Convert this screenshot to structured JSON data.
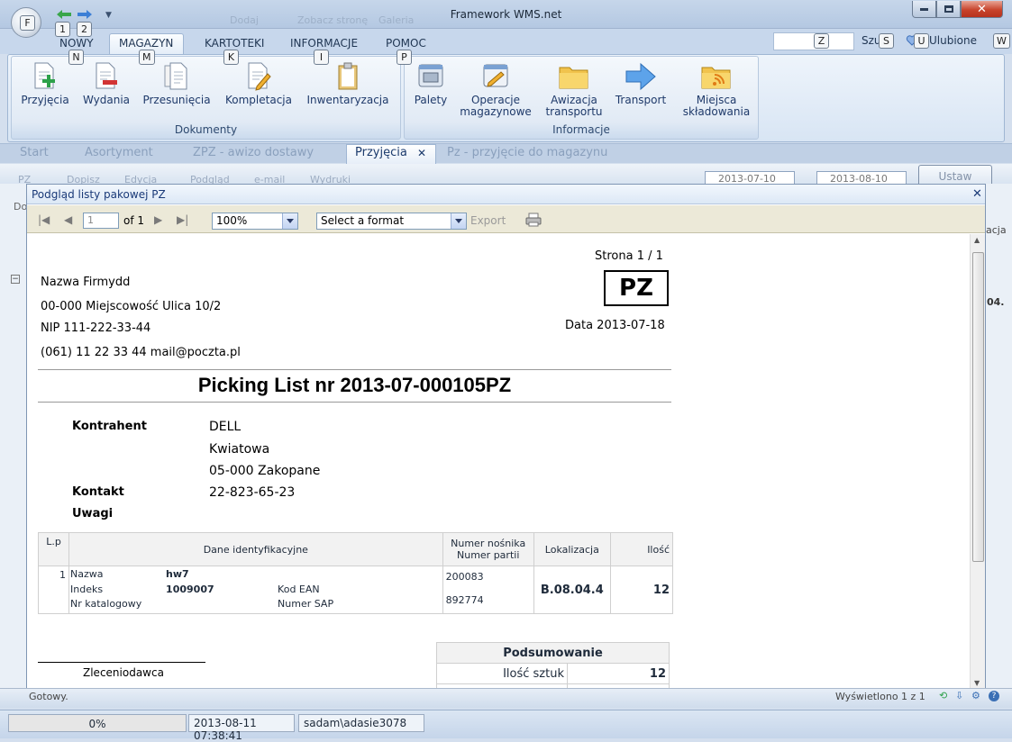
{
  "window": {
    "title": "Framework WMS.net",
    "app_button_key": "F",
    "qat_keys": [
      "1",
      "2"
    ],
    "ghost_items": [
      "Dodaj",
      "Zobacz stronę",
      "Galeria"
    ]
  },
  "ribbon": {
    "tabs": [
      {
        "label": "NOWY",
        "key": "N"
      },
      {
        "label": "MAGAZYN",
        "key": "M"
      },
      {
        "label": "KARTOTEKI",
        "key": "K"
      },
      {
        "label": "INFORMACJE",
        "key": "I"
      },
      {
        "label": "POMOC",
        "key": "P"
      }
    ],
    "search_key": "Z",
    "search_label": "Szuj",
    "search_key2": "S",
    "favorites_key": "U",
    "favorites_label": "Ulubione",
    "extra_key": "W",
    "groups": [
      {
        "label": "Dokumenty",
        "buttons": [
          "Przyjęcia",
          "Wydania",
          "Przesunięcia",
          "Kompletacja",
          "Inwentaryzacja"
        ]
      },
      {
        "label": "Informacje",
        "buttons": [
          "Palety",
          "Operacje magazynowe",
          "Awizacja transportu",
          "Transport",
          "Miejsca składowania"
        ]
      }
    ]
  },
  "doc_tabs": [
    "Start",
    "Asortyment",
    "ZPZ - awizo dostawy",
    "Przyjęcia",
    "Pz - przyjęcie do magazynu"
  ],
  "toolbar": {
    "items": [
      "PZ",
      "Dopisz",
      "Edycja",
      "Podgląd",
      "e-mail",
      "Wydruki"
    ],
    "date_from": "2013-07-10",
    "date_to": "2013-08-10",
    "apply_button": "Ustaw",
    "side_partial": [
      "Do",
      "acja",
      "04."
    ]
  },
  "dialog": {
    "title": "Podgląd listy pakowej PZ",
    "page_value": "1",
    "page_of": "of 1",
    "zoom": "100%",
    "format_placeholder": "Select a format",
    "export_label": "Export"
  },
  "report": {
    "page_label": "Strona 1 / 1",
    "doc_type": "PZ",
    "date_label": "Data 2013-07-18",
    "company": {
      "name": "Nazwa Firmydd",
      "address": "00-000 Miejscowość Ulica 10/2",
      "nip": "NIP 111-222-33-44",
      "contact": "(061) 11 22 33 44 mail@poczta.pl"
    },
    "heading": "Picking List nr 2013-07-000105PZ",
    "party": {
      "contractor_label": "Kontrahent",
      "contractor_name": "DELL",
      "street": "Kwiatowa",
      "city": "05-000 Zakopane",
      "contact_label": "Kontakt",
      "contact_value": "22-823-65-23",
      "notes_label": "Uwagi"
    },
    "table": {
      "headers": {
        "lp": "L.p",
        "ident": "Dane identyfikacyjne",
        "carrier_line1": "Numer nośnika",
        "carrier_line2": "Numer partii",
        "location": "Lokalizacja",
        "qty": "Ilość"
      },
      "row": {
        "lp": "1",
        "name_label": "Nazwa",
        "name_value": "hw7",
        "index_label": "Indeks",
        "index_value": "1009007",
        "catalog_label": "Nr katalogowy",
        "ean_label": "Kod EAN",
        "sap_label": "Numer SAP",
        "carrier": "200083",
        "batch": "892774",
        "location": "B.08.04.4",
        "qty": "12"
      }
    },
    "signature_label": "Zleceniodawca",
    "summary": {
      "title": "Podsumowanie",
      "qty_label": "Ilość sztuk",
      "qty_value": "12"
    }
  },
  "status": {
    "left_text": "Gotowy.",
    "right_text": "Wyświetlono 1 z 1",
    "progress": "0%",
    "progress_fraction": 0,
    "datetime": "2013-08-11 07:38:41",
    "user": "sadam\\adasie3078"
  }
}
